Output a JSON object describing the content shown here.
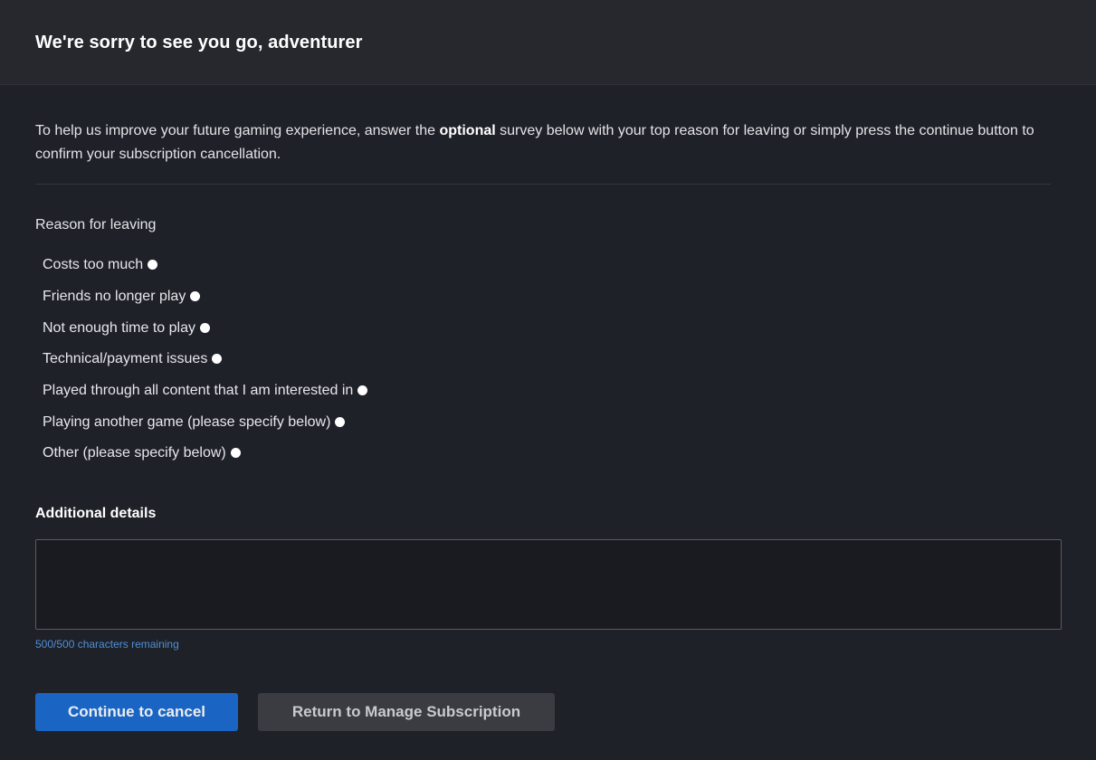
{
  "header": {
    "title": "We're sorry to see you go, adventurer"
  },
  "intro": {
    "before": "To help us improve your future gaming experience, answer the ",
    "emphasis": "optional",
    "after": " survey below with your top reason for leaving or simply press the continue button to confirm your subscription cancellation."
  },
  "survey": {
    "label": "Reason for leaving",
    "options": [
      "Costs too much",
      "Friends no longer play",
      "Not enough time to play",
      "Technical/payment issues",
      "Played through all content that I am interested in",
      "Playing another game (please specify below)",
      "Other (please specify below)"
    ]
  },
  "details": {
    "label": "Additional details",
    "value": "",
    "placeholder": "",
    "char_count": "500/500 characters remaining"
  },
  "actions": {
    "continue_label": "Continue to cancel",
    "return_label": "Return to Manage Subscription"
  },
  "colors": {
    "accent": "#1a6bd1",
    "link": "#4d8fd8",
    "background": "#1f2128"
  }
}
